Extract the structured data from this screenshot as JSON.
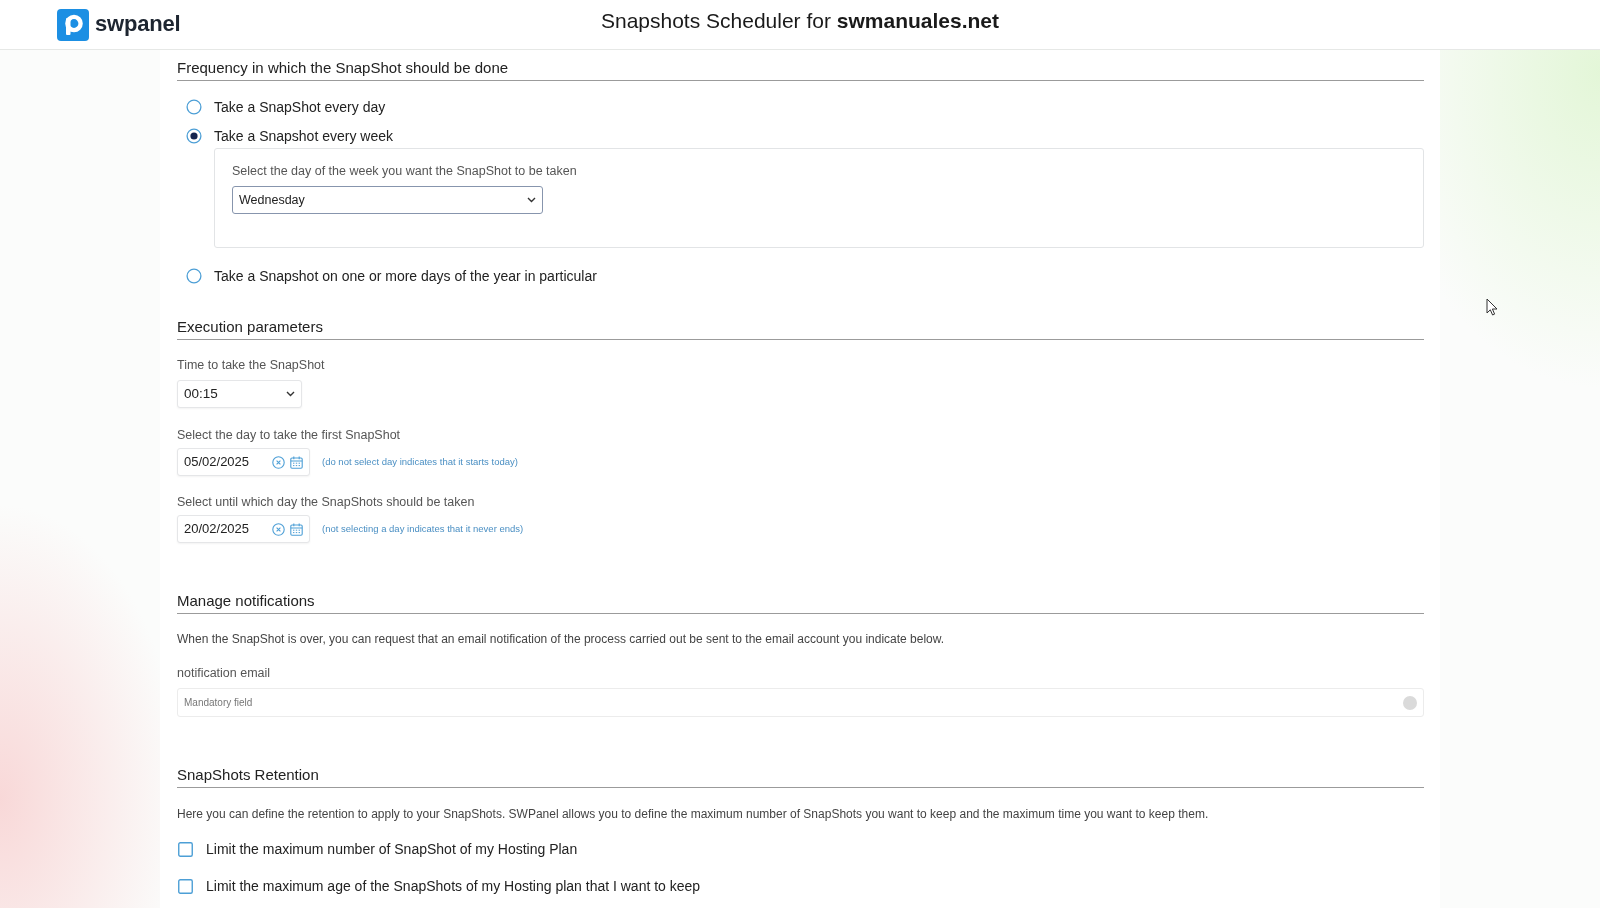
{
  "header": {
    "brand": "swpanel",
    "title": "Snapshots Scheduler for **swmanuales.net**"
  },
  "frequency": {
    "heading": "Frequency in which the SnapShot should be done",
    "options": [
      {
        "label": "Take a SnapShot every day",
        "selected": false
      },
      {
        "label": "Take a Snapshot every week",
        "selected": true,
        "weekday": {
          "label": "Select the day of the week you want the SnapShot to be taken",
          "value": "Wednesday"
        }
      },
      {
        "label": "Take a Snapshot on one or more days of the year in particular",
        "selected": false
      }
    ]
  },
  "execution": {
    "heading": "Execution parameters",
    "time": {
      "label": "Time to take the SnapShot",
      "value": "00:15"
    },
    "dates": [
      {
        "label": "Select the day to take the first SnapShot",
        "value": "05/02/2025",
        "hint": "(do not select day indicates that it starts today)"
      },
      {
        "label": "Select until which day the SnapShots should be taken",
        "value": "20/02/2025",
        "hint": "(not selecting a day indicates that it never ends)"
      }
    ]
  },
  "notifications": {
    "heading": "Manage notifications",
    "description": "When the SnapShot is over, you can request that an email notification of the process carried out be sent to the email account you indicate below.",
    "email": {
      "label": "notification email",
      "placeholder": "Mandatory field"
    }
  },
  "retention": {
    "heading": "SnapShots Retention",
    "description": "Here you can define the retention to apply to your SnapShots. SWPanel allows you to define the maximum number of SnapShots you want to keep and the maximum time you want to keep them.",
    "options": [
      {
        "label": "Limit the maximum number of SnapShot of my Hosting Plan",
        "checked": false
      },
      {
        "label": "Limit the maximum age of the SnapShots of my Hosting plan that I want to keep",
        "checked": false
      }
    ]
  }
}
